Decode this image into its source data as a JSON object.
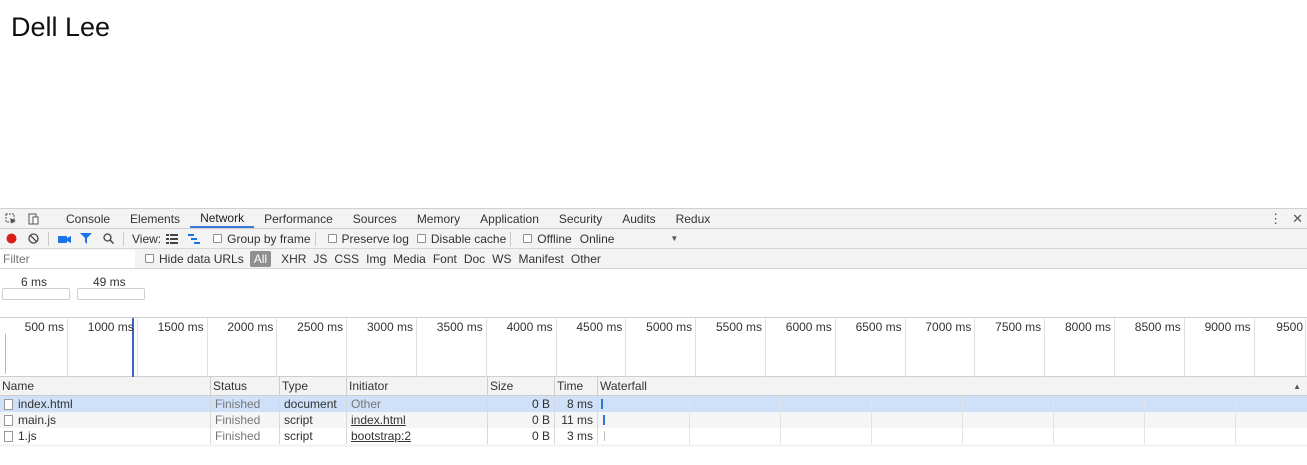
{
  "page": {
    "heading": "Dell Lee"
  },
  "devtools": {
    "tabs": [
      "Console",
      "Elements",
      "Network",
      "Performance",
      "Sources",
      "Memory",
      "Application",
      "Security",
      "Audits",
      "Redux"
    ],
    "active_tab": "Network",
    "toolbar": {
      "view_label": "View:",
      "group_by_frame": "Group by frame",
      "preserve_log": "Preserve log",
      "disable_cache": "Disable cache",
      "offline": "Offline",
      "throttling": "Online"
    },
    "filterbar": {
      "placeholder": "Filter",
      "hide_data_urls": "Hide data URLs",
      "types": [
        "All",
        "XHR",
        "JS",
        "CSS",
        "Img",
        "Media",
        "Font",
        "Doc",
        "WS",
        "Manifest",
        "Other"
      ]
    },
    "overview": {
      "label_a": "6 ms",
      "label_b": "49 ms"
    },
    "ruler_ticks": [
      "500 ms",
      "1000 ms",
      "1500 ms",
      "2000 ms",
      "2500 ms",
      "3000 ms",
      "3500 ms",
      "4000 ms",
      "4500 ms",
      "5000 ms",
      "5500 ms",
      "6000 ms",
      "6500 ms",
      "7000 ms",
      "7500 ms",
      "8000 ms",
      "8500 ms",
      "9000 ms",
      "9500"
    ],
    "table": {
      "headers": {
        "name": "Name",
        "status": "Status",
        "type": "Type",
        "initiator": "Initiator",
        "size": "Size",
        "time": "Time",
        "waterfall": "Waterfall"
      },
      "rows": [
        {
          "name": "index.html",
          "status": "Finished",
          "type": "document",
          "initiator": "Other",
          "size": "0 B",
          "time": "8 ms"
        },
        {
          "name": "main.js",
          "status": "Finished",
          "type": "script",
          "initiator": "index.html",
          "size": "0 B",
          "time": "11 ms"
        },
        {
          "name": "1.js",
          "status": "Finished",
          "type": "script",
          "initiator": "bootstrap:2",
          "size": "0 B",
          "time": "3 ms"
        }
      ]
    },
    "colors": {
      "accent": "#3879d9",
      "record": "#d91e18",
      "selected_row": "#cfe1f8"
    }
  }
}
